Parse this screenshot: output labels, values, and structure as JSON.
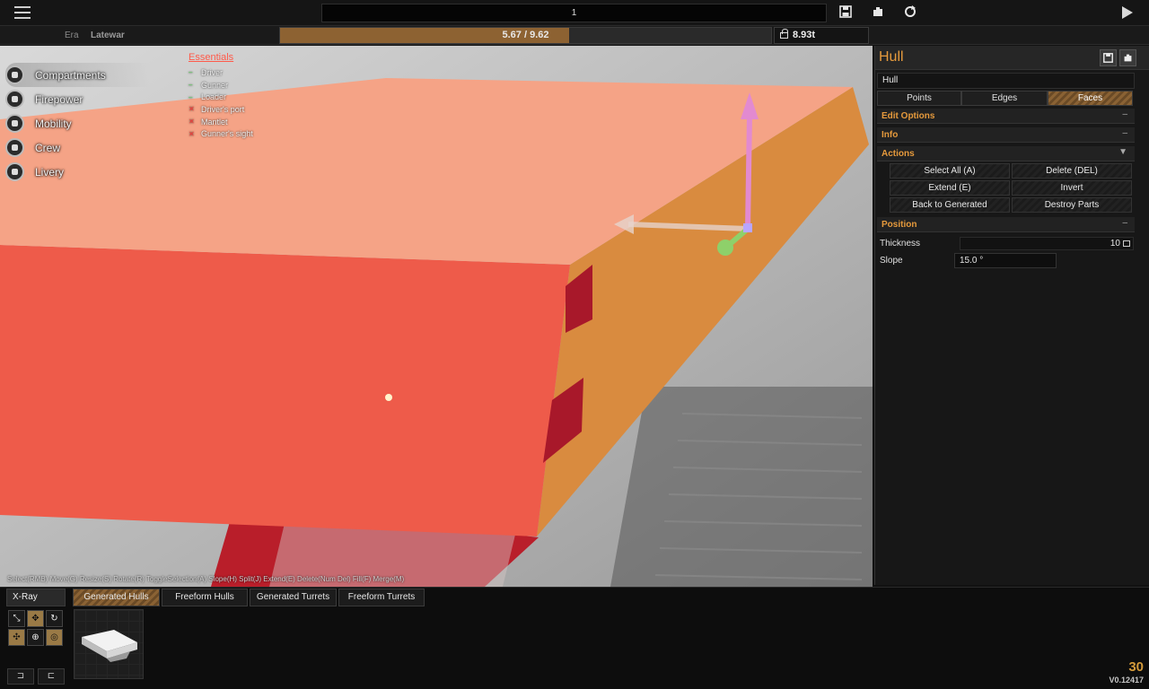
{
  "top": {
    "vehicle_name": "1",
    "icons": [
      "save-icon",
      "load-icon",
      "refresh-icon",
      "play-icon"
    ]
  },
  "subbar": {
    "era_label": "Era",
    "era_value": "Latewar",
    "weight_text": "5.67 / 9.62",
    "weight_current": 5.67,
    "weight_max": 9.62,
    "tonnage": "8.93t"
  },
  "left_menu": [
    {
      "label": "Compartments",
      "icon": "cube-icon",
      "active": true
    },
    {
      "label": "Firepower",
      "icon": "cannon-icon",
      "active": false
    },
    {
      "label": "Mobility",
      "icon": "wheel-icon",
      "active": false
    },
    {
      "label": "Crew",
      "icon": "person-icon",
      "active": false
    },
    {
      "label": "Livery",
      "icon": "brush-icon",
      "active": false
    }
  ],
  "essentials": {
    "title": "Essentials",
    "items": [
      {
        "label": "Driver",
        "ok": true
      },
      {
        "label": "Gunner",
        "ok": true
      },
      {
        "label": "Loader",
        "ok": true
      },
      {
        "label": "Driver's port",
        "ok": false
      },
      {
        "label": "Mantlet",
        "ok": false
      },
      {
        "label": "Gunner's sight",
        "ok": false
      }
    ]
  },
  "hint": "Select(RMB) Move(G) Resize(S) Rotate(R) ToggleSelection(A) Slope(H) Split(J) Extend(E) Delete(Num Del) Fill(F) Merge(M)",
  "panel": {
    "title": "Hull",
    "part_name": "Hull",
    "modes": [
      {
        "label": "Points",
        "active": false
      },
      {
        "label": "Edges",
        "active": false
      },
      {
        "label": "Faces",
        "active": true
      }
    ],
    "sections": {
      "edit_options": {
        "label": "Edit Options",
        "toggle": "–"
      },
      "info": {
        "label": "Info",
        "toggle": "–"
      },
      "actions": {
        "label": "Actions",
        "toggle": "▼"
      },
      "position": {
        "label": "Position",
        "toggle": "–"
      }
    },
    "actions": [
      "Select All (A)",
      "Delete (DEL)",
      "Extend (E)",
      "Invert",
      "Back to Generated",
      "Destroy Parts"
    ],
    "thickness_label": "Thickness",
    "thickness_value": "10",
    "slope_label": "Slope",
    "slope_value": "15.0 °"
  },
  "bottom": {
    "xray_label": "X-Ray",
    "tabs": [
      {
        "label": "Generated Hulls",
        "active": true
      },
      {
        "label": "Freeform Hulls",
        "active": false
      },
      {
        "label": "Generated Turrets",
        "active": false
      },
      {
        "label": "Freeform Turrets",
        "active": false
      }
    ],
    "fps": "30",
    "version": "V0.12417"
  },
  "colors": {
    "accent": "#e69a3c",
    "hull_top": "#f5a386",
    "hull_front": "#ee5b4a",
    "hull_side": "#d98b3f",
    "weight_fill": "#8d6232"
  }
}
